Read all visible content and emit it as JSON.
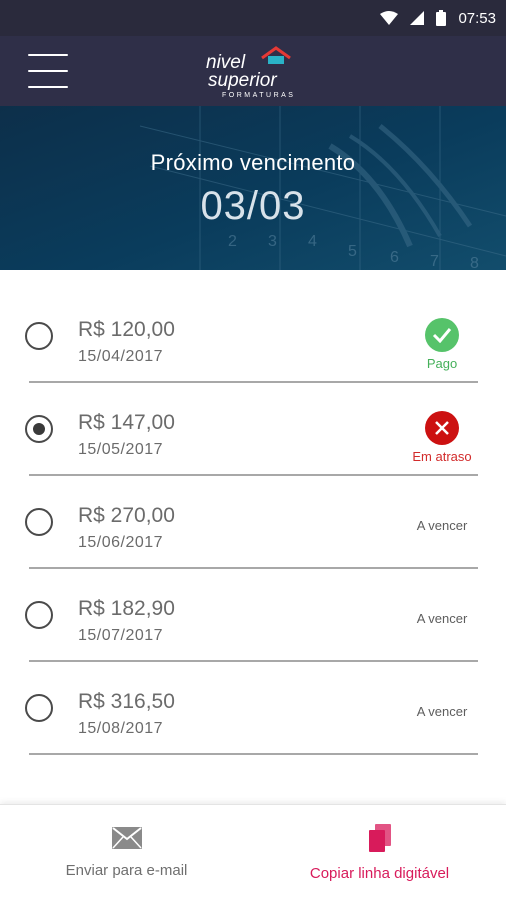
{
  "status_bar": {
    "time": "07:53",
    "icons": [
      "wifi-icon",
      "signal-icon",
      "battery-icon"
    ]
  },
  "app_bar": {
    "logo_line1": "nivel",
    "logo_line2": "superior",
    "logo_tagline": "FORMATURAS",
    "menu_icon": "hamburger-menu-icon"
  },
  "hero": {
    "title": "Próximo vencimento",
    "date": "03/03"
  },
  "colors": {
    "accent": "#d81b5b",
    "paid": "#56c36a",
    "overdue": "#cc1111",
    "header": "#2f2f48"
  },
  "installments": [
    {
      "amount": "R$ 120,00",
      "due_date": "15/04/2017",
      "status": "Pago",
      "status_type": "paid",
      "selected": false
    },
    {
      "amount": "R$ 147,00",
      "due_date": "15/05/2017",
      "status": "Em atraso",
      "status_type": "overdue",
      "selected": true
    },
    {
      "amount": "R$ 270,00",
      "due_date": "15/06/2017",
      "status": "A vencer",
      "status_type": "pending",
      "selected": false
    },
    {
      "amount": "R$ 182,90",
      "due_date": "15/07/2017",
      "status": "A vencer",
      "status_type": "pending",
      "selected": false
    },
    {
      "amount": "R$ 316,50",
      "due_date": "15/08/2017",
      "status": "A vencer",
      "status_type": "pending",
      "selected": false
    }
  ],
  "bottom_bar": {
    "email_label": "Enviar para e-mail",
    "email_icon": "envelope-icon",
    "copy_label": "Copiar linha digitável",
    "copy_icon": "copy-icon"
  }
}
